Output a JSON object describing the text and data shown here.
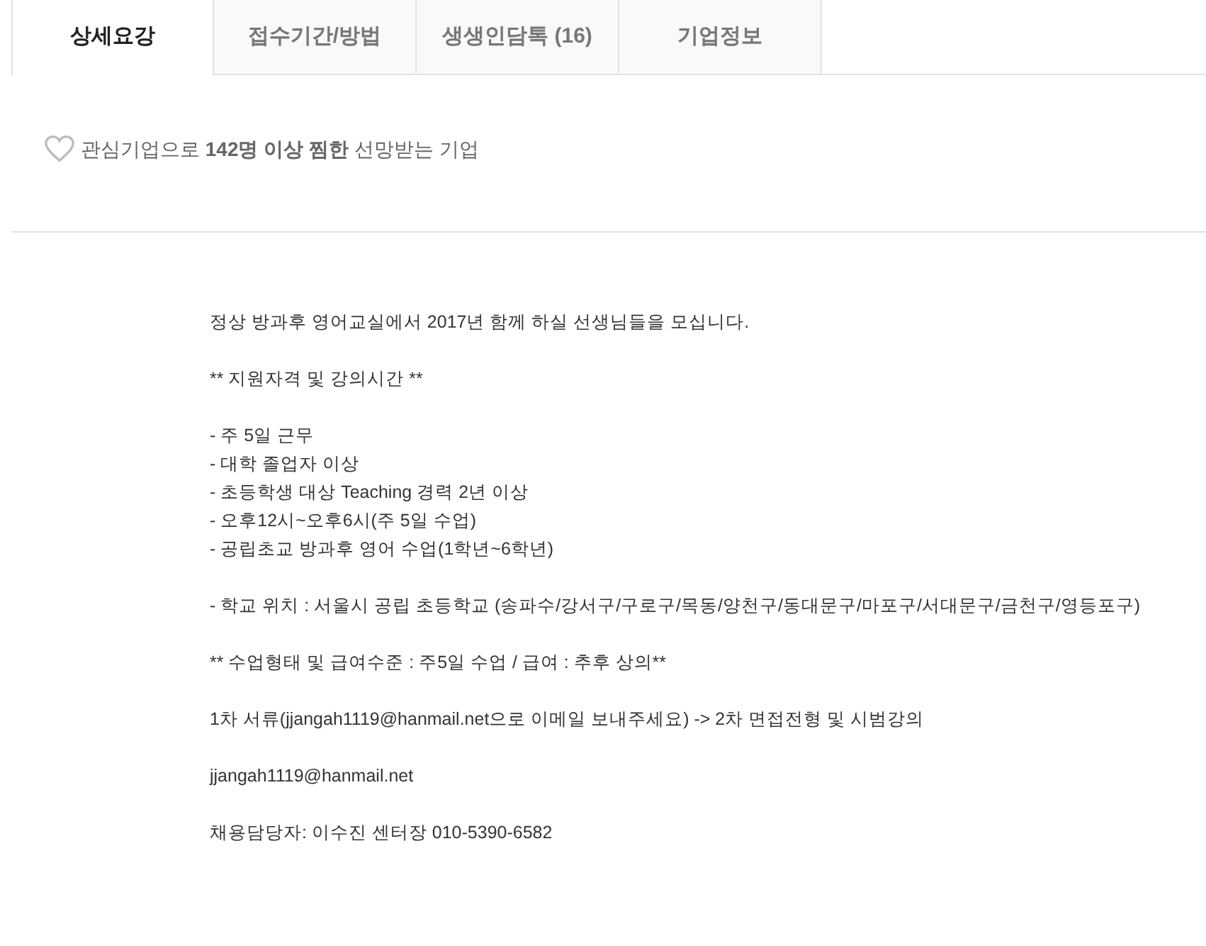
{
  "tabs": [
    {
      "label": "상세요강",
      "selected": true
    },
    {
      "label": "접수기간/방법",
      "selected": false
    },
    {
      "label": "생생인담톡 (16)",
      "selected": false
    },
    {
      "label": "기업정보",
      "selected": false
    }
  ],
  "interest": {
    "text": "관심기업으로 **142명 이상 찜한** 선망받는 기업"
  },
  "description": [
    [
      "정상 방과후 영어교실에서 2017년 함께 하실 선생님들을 모십니다."
    ],
    [
      "** 지원자격 및 강의시간 **"
    ],
    [
      "- 주 5일 근무",
      "- 대학 졸업자 이상",
      "- 초등학생 대상 Teaching 경력 2년 이상",
      "- 오후12시~오후6시(주 5일 수업)",
      "- 공립초교 방과후 영어 수업(1학년~6학년)"
    ],
    [
      "- 학교 위치 : 서울시 공립 초등학교 (송파수/강서구/구로구/목동/양천구/동대문구/마포구/서대문구/금천구/영등포구)"
    ],
    [
      "** 수업형태 및 급여수준 : 주5일 수업 / 급여 : 추후 상의**"
    ],
    [
      "1차 서류(jjangah1119@hanmail.net으로 이메일 보내주세요) -> 2차 면접전형 및 시범강의"
    ],
    [
      "jjangah1119@hanmail.net"
    ],
    [
      "채용담당자: 이수진 센터장 010-5390-6582"
    ]
  ]
}
